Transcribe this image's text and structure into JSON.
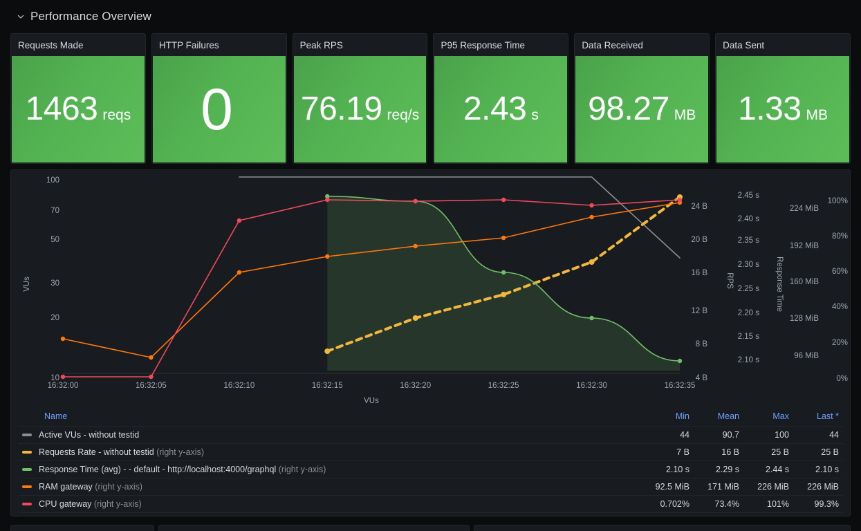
{
  "row": {
    "title": "Performance Overview",
    "chevron_icon": "chevron-down-icon"
  },
  "stats": [
    {
      "title": "Requests Made",
      "value": "1463",
      "unit": "reqs",
      "color": "#56b450",
      "big": false
    },
    {
      "title": "HTTP Failures",
      "value": "0",
      "unit": "",
      "color": "#56b450",
      "big": true
    },
    {
      "title": "Peak RPS",
      "value": "76.19",
      "unit": "req/s",
      "color": "#56b450",
      "big": false
    },
    {
      "title": "P95 Response Time",
      "value": "2.43",
      "unit": "s",
      "color": "#56b450",
      "big": false
    },
    {
      "title": "Data Received",
      "value": "98.27",
      "unit": "MB",
      "color": "#56b450",
      "big": false
    },
    {
      "title": "Data Sent",
      "value": "1.33",
      "unit": "MB",
      "color": "#56b450",
      "big": false
    }
  ],
  "chart_data": {
    "type": "line",
    "title": "",
    "xlabel": "VUs",
    "grid": false,
    "legend_position": "bottom-table",
    "x": [
      "16:32:00",
      "16:32:05",
      "16:32:10",
      "16:32:15",
      "16:32:20",
      "16:32:25",
      "16:32:30",
      "16:32:35"
    ],
    "x_tick_labels": [
      "16:32:00",
      "16:32:05",
      "16:32:10",
      "16:32:15",
      "16:32:20",
      "16:32:25",
      "16:32:30",
      "16:32:35"
    ],
    "axes": [
      {
        "name": "VUs",
        "side": "left",
        "label": "VUs",
        "ticks": [
          "100",
          "70",
          "50",
          "30",
          "20",
          "10"
        ],
        "scale": "log"
      },
      {
        "name": "RPS",
        "side": "right",
        "label": "RPS",
        "ticks": [
          "24 B",
          "20 B",
          "16 B",
          "12 B",
          "8 B",
          "4 B"
        ]
      },
      {
        "name": "Response Time",
        "side": "right",
        "label": "Response Time",
        "ticks": [
          "2.45 s",
          "2.40 s",
          "2.35 s",
          "2.30 s",
          "2.25 s",
          "2.20 s",
          "2.15 s",
          "2.10 s"
        ]
      },
      {
        "name": "Memory",
        "side": "right",
        "label": "",
        "ticks": [
          "224 MiB",
          "192 MiB",
          "160 MiB",
          "128 MiB",
          "96 MiB"
        ]
      },
      {
        "name": "CPU",
        "side": "right",
        "label": "",
        "ticks": [
          "100%",
          "80%",
          "60%",
          "40%",
          "20%",
          "0%"
        ]
      }
    ],
    "series": [
      {
        "name": "Active VUs - without testid",
        "color": "#8e8e8e",
        "axis": "left",
        "style": "line",
        "fill": false,
        "points": false,
        "values": [
          null,
          null,
          100,
          100,
          100,
          100,
          100,
          44
        ]
      },
      {
        "name": "Requests Rate - without testid",
        "color": "#f2b73d",
        "axis": "RPS",
        "style": "dashed",
        "fill": false,
        "points": true,
        "values": [
          null,
          null,
          null,
          7,
          12,
          16,
          21,
          25
        ]
      },
      {
        "name": "Response Time (avg) - - default - http://localhost:4000/graphql",
        "color": "#73bf69",
        "axis": "Response Time",
        "style": "line",
        "fill": true,
        "points": true,
        "values": [
          null,
          null,
          null,
          2.44,
          2.43,
          2.29,
          2.18,
          2.1
        ]
      },
      {
        "name": "RAM gateway",
        "color": "#ff780a",
        "axis": "Memory",
        "style": "line",
        "fill": false,
        "points": true,
        "values": [
          92.5,
          80,
          140,
          152,
          164,
          176,
          200,
          226
        ]
      },
      {
        "name": "CPU gateway",
        "color": "#f2495c",
        "axis": "CPU",
        "style": "line",
        "fill": false,
        "points": true,
        "values": [
          0.702,
          0.702,
          73,
          101,
          100,
          101,
          99,
          99.3
        ]
      }
    ]
  },
  "legend": {
    "columns": [
      "Name",
      "Min",
      "Mean",
      "Max",
      "Last *"
    ],
    "rows": [
      {
        "color": "#8e8e8e",
        "name": "Active VUs - without testid",
        "axis_note": "",
        "min": "44",
        "mean": "90.7",
        "max": "100",
        "last": "44"
      },
      {
        "color": "#f2b73d",
        "name": "Requests Rate - without testid",
        "axis_note": "(right y-axis)",
        "min": "7 B",
        "mean": "16 B",
        "max": "25 B",
        "last": "25 B"
      },
      {
        "color": "#73bf69",
        "name": "Response Time (avg) - - default - http://localhost:4000/graphql",
        "axis_note": "(right y-axis)",
        "min": "2.10 s",
        "mean": "2.29 s",
        "max": "2.44 s",
        "last": "2.10 s"
      },
      {
        "color": "#ff780a",
        "name": "RAM gateway",
        "axis_note": "(right y-axis)",
        "min": "92.5 MiB",
        "mean": "171 MiB",
        "max": "226 MiB",
        "last": "226 MiB"
      },
      {
        "color": "#f2495c",
        "name": "CPU gateway",
        "axis_note": "(right y-axis)",
        "min": "0.702%",
        "mean": "73.4%",
        "max": "101%",
        "last": "99.3%"
      }
    ]
  }
}
